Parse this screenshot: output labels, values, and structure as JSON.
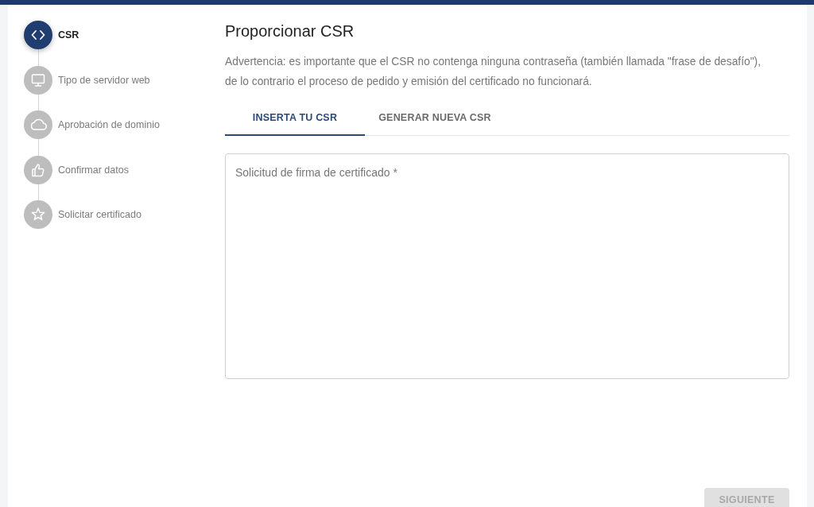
{
  "steps": [
    {
      "label": "CSR",
      "kind": "code",
      "selected": true
    },
    {
      "label": "Tipo de servidor web",
      "kind": "monitor",
      "selected": false
    },
    {
      "label": "Aprobación de dominio",
      "kind": "cloud",
      "selected": false
    },
    {
      "label": "Confirmar datos",
      "kind": "thumbs-up",
      "selected": false
    },
    {
      "label": "Solicitar certificado",
      "kind": "star",
      "selected": false
    }
  ],
  "main": {
    "title": "Proporcionar CSR",
    "warning": "Advertencia: es importante que el CSR no contenga ninguna contraseña (también llamada \"frase de desafío\"), de lo contrario el proceso de pedido y emisión del certificado no funcionará.",
    "tabs": [
      {
        "label": "INSERTA TU CSR",
        "selected": true
      },
      {
        "label": "GENERAR NUEVA CSR",
        "selected": false
      }
    ],
    "csr_field": {
      "placeholder": "Solicitud de firma de certificado *"
    },
    "next_button": {
      "label": "SIGUIENTE",
      "disabled": true
    }
  }
}
